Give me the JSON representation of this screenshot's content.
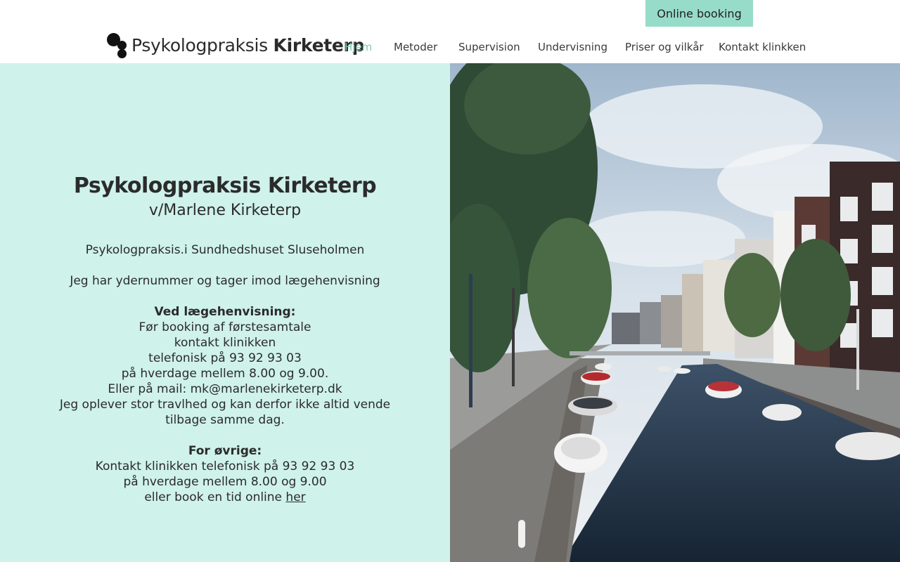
{
  "header": {
    "booking_label": "Online booking",
    "logo_light": "Psykologpraksis",
    "logo_bold": "Kirketerp"
  },
  "nav": {
    "items": [
      {
        "label": "Hjem",
        "active": true
      },
      {
        "label": "Metoder"
      },
      {
        "label": "Supervision"
      },
      {
        "label": "Undervisning"
      },
      {
        "label": "Priser og vilkår"
      },
      {
        "label": "Kontakt klinkken"
      }
    ]
  },
  "main": {
    "title_light": "Psykologpraksis",
    "title_bold": "Kirketerp",
    "subtitle": "v/Marlene Kirketerp",
    "location": "Psykologpraksis.i Sundhedshuset Sluseholmen",
    "ydernummer": "Jeg har ydernummer og tager imod lægehenvisning",
    "referral_heading": "Ved lægehenvisning:",
    "referral_lines": [
      "Før booking af førstesamtale",
      "kontakt klinikken",
      "telefonisk på 93 92 93 03",
      "på hverdage mellem 8.00 og 9.00.",
      "Eller på mail: mk@marlenekirketerp.dk",
      "Jeg oplever stor travlhed og kan derfor ikke altid vende",
      "tilbage samme dag."
    ],
    "others_heading": "For øvrige:",
    "others_lines": [
      "Kontakt klinikken telefonisk på 93 92 93 03",
      "på hverdage mellem 8.00 og 9.00"
    ],
    "book_online_text": "eller book en tid online ",
    "book_online_link": "her"
  },
  "colors": {
    "accent": "#97dcc8",
    "panel_bg": "#cff2ea",
    "nav_active": "#7fc9b4",
    "text": "#2b2b2b"
  }
}
